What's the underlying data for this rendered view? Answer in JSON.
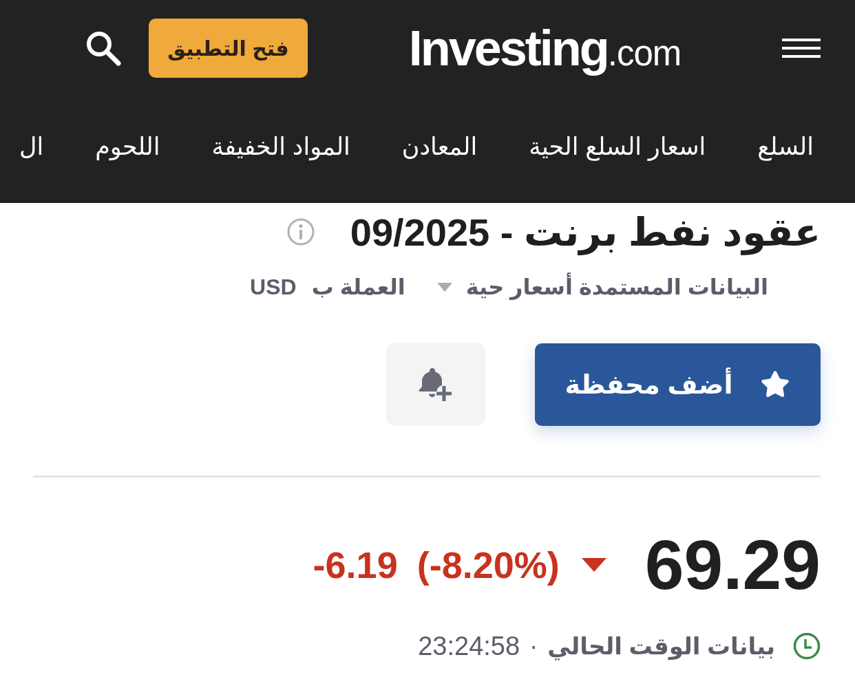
{
  "logo": {
    "name": "Investing",
    "suffix": ".com"
  },
  "open_app_button": "فتح التطبيق",
  "nav": [
    "السلع",
    "اسعار السلع الحية",
    "المعادن",
    "المواد الخفيفة",
    "اللحوم",
    "ال"
  ],
  "title": "عقود نفط برنت - 09/2025",
  "data_source": "البيانات المستمدة أسعار حية",
  "currency": {
    "label": "العملة ب",
    "value": "USD"
  },
  "portfolio_button": "أضف محفظة",
  "quote": {
    "price": "69.29",
    "down": true,
    "change": "-6.19",
    "change_percent": "(-8.20%)"
  },
  "status": {
    "label": "بيانات الوقت الحالي",
    "separator": "·",
    "time": "23:24:58"
  }
}
